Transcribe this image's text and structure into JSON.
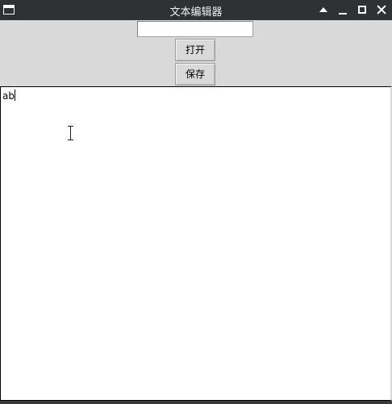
{
  "window": {
    "title": "文本编辑器",
    "controls": [
      "shade-icon",
      "minimize-icon",
      "maximize-icon",
      "close-icon"
    ]
  },
  "toolbar": {
    "filename_value": "",
    "filename_placeholder": "",
    "open_label": "打开",
    "save_label": "保存"
  },
  "editor": {
    "content": "ab"
  },
  "colors": {
    "titlebar_bg": "#2f3133",
    "window_bg": "#d9d9d9",
    "editor_bg": "#ffffff"
  }
}
